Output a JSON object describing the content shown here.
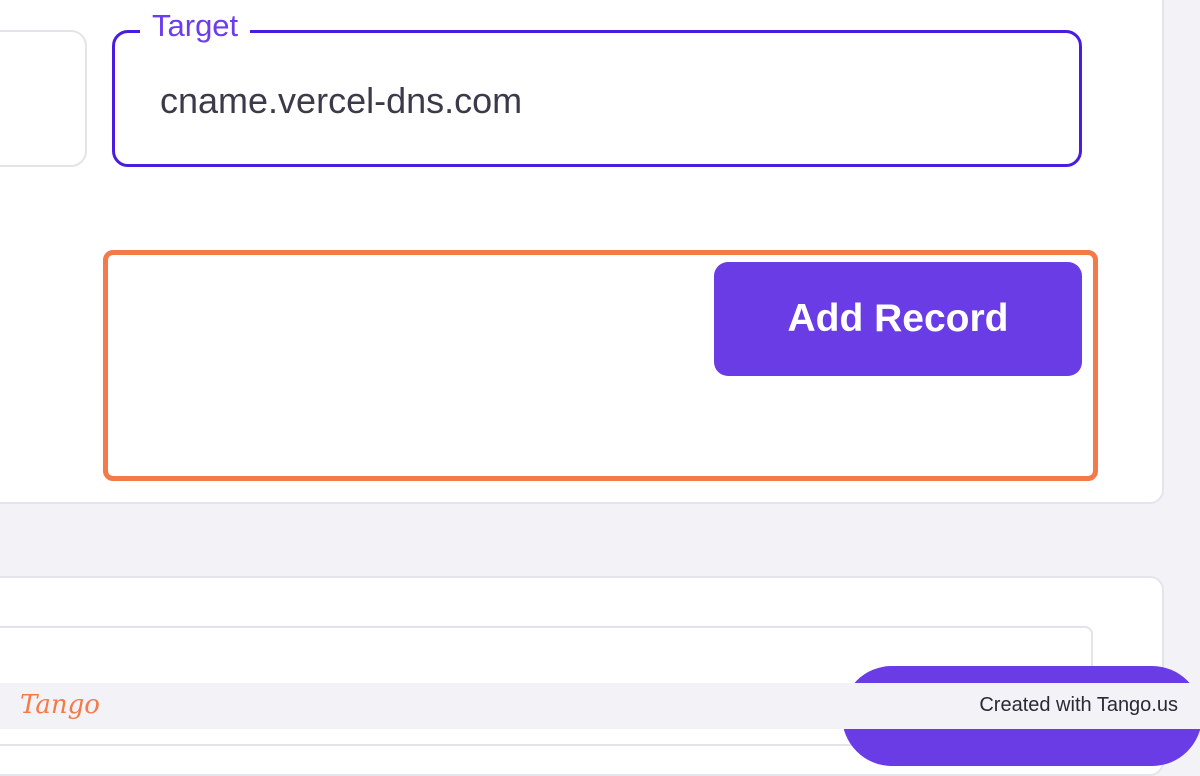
{
  "target_field": {
    "label": "Target",
    "value": "cname.vercel-dns.com"
  },
  "add_record_button": {
    "label": "Add Record"
  },
  "footer": {
    "logo_text": "Tango",
    "credit": "Created with Tango.us"
  },
  "colors": {
    "accent": "#6a3ce6",
    "focus_border": "#4a1ce0",
    "highlight": "#f47a48",
    "background": "#f2f2f7"
  }
}
